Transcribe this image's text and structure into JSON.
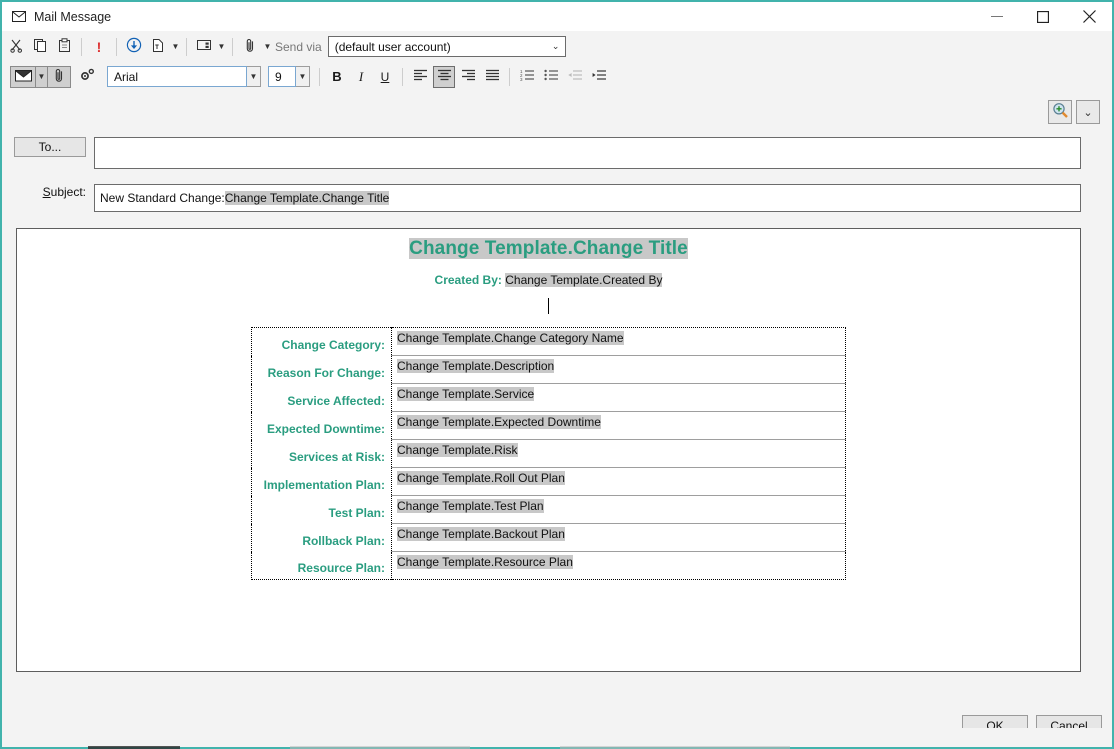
{
  "window": {
    "title": "Mail Message",
    "icon": "envelope-icon",
    "minimize_label": "—",
    "maximize_label": "□",
    "close_label": "✕",
    "accent_color": "#41b3ac"
  },
  "toolbar_primary": {
    "buttons": [
      {
        "name": "cut-button",
        "icon": "scissors-icon",
        "label": "Cut"
      },
      {
        "name": "copy-button",
        "icon": "copy-icon",
        "label": "Copy"
      },
      {
        "name": "paste-button",
        "icon": "clipboard-icon",
        "label": "Paste"
      },
      {
        "name": "priority-button",
        "icon": "exclamation-icon",
        "label": "!"
      },
      {
        "name": "receive-button",
        "icon": "download-circle-icon",
        "label": "Receive"
      },
      {
        "name": "insert-file-button",
        "icon": "page-icon",
        "label": "Insert File"
      },
      {
        "name": "layout-button",
        "icon": "panes-icon",
        "label": "Layout"
      },
      {
        "name": "attach-button",
        "icon": "paperclip-icon",
        "label": "Attach"
      }
    ],
    "send_via_label": "Send via",
    "send_via_account": "(default user account)",
    "send_via_options": [
      "(default user account)"
    ]
  },
  "toolbar_format": {
    "send_button": {
      "name": "send-button",
      "icon": "envelope-check-icon"
    },
    "attach_button": {
      "name": "attach-button-2",
      "icon": "paperclip-icon"
    },
    "settings_button": {
      "name": "settings-gear-button",
      "icon": "gear-icon"
    },
    "font_family": "Arial",
    "font_size": "9",
    "bold_label": "B",
    "italic_label": "I",
    "underline_label": "U",
    "align_left": "align-left-icon",
    "align_center": "align-center-icon",
    "align_right": "align-right-icon",
    "align_justify": "align-justify-icon",
    "list_numbered": "numbered-list-icon",
    "list_bullet": "bullet-list-icon",
    "outdent": "outdent-icon",
    "indent": "indent-icon",
    "active_alignment": "align-center"
  },
  "zoom_controls": {
    "zoom_in_icon": "magnifier-plus-icon",
    "dropdown_icon": "chevron-down-icon"
  },
  "header_fields": {
    "to_button_label": "To...",
    "to_value": "",
    "subject_label_prefix": "S",
    "subject_label_rest": "ubject:",
    "subject_plain": "New Standard Change: ",
    "subject_token": "Change Template.Change Title"
  },
  "document": {
    "title_token": "Change Template.Change Title",
    "created_by_label": "Created By:",
    "created_by_token": "Change Template.Created By",
    "accent_text_color": "#2a9d80",
    "token_highlight_color": "#c8c8c8",
    "rows": [
      {
        "label": "Change Category:",
        "value": "Change Template.Change Category Name"
      },
      {
        "label": "Reason For Change:",
        "value": "Change Template.Description"
      },
      {
        "label": "Service Affected:",
        "value": "Change Template.Service"
      },
      {
        "label": "Expected Downtime:",
        "value": "Change Template.Expected Downtime"
      },
      {
        "label": "Services at Risk:",
        "value": "Change Template.Risk"
      },
      {
        "label": "Implementation Plan:",
        "value": "Change Template.Roll Out Plan"
      },
      {
        "label": "Test Plan:",
        "value": "Change Template.Test Plan"
      },
      {
        "label": "Rollback Plan:",
        "value": "Change Template.Backout Plan"
      },
      {
        "label": "Resource Plan:",
        "value": "Change Template.Resource Plan"
      }
    ]
  },
  "footer": {
    "ok_label": "OK",
    "cancel_label": "Cancel"
  }
}
